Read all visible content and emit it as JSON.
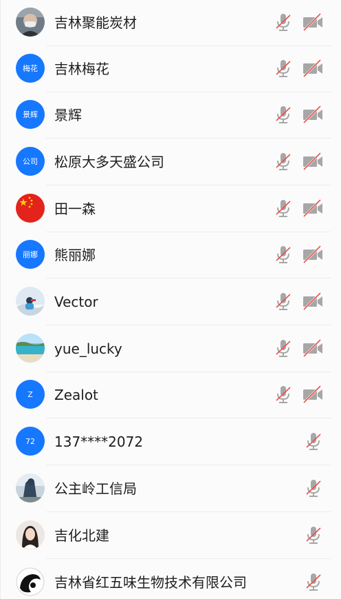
{
  "participants": [
    {
      "name": "吉林聚能炭材",
      "avatar_text": "",
      "avatar_kind": "photo-mask",
      "mic_muted": true,
      "camera_off": true,
      "has_camera_icon": true
    },
    {
      "name": "吉林梅花",
      "avatar_text": "梅花",
      "avatar_kind": "text",
      "mic_muted": true,
      "camera_off": true,
      "has_camera_icon": true
    },
    {
      "name": "景辉",
      "avatar_text": "景辉",
      "avatar_kind": "text",
      "mic_muted": true,
      "camera_off": true,
      "has_camera_icon": true
    },
    {
      "name": "松原大多天盛公司",
      "avatar_text": "公司",
      "avatar_kind": "text",
      "mic_muted": true,
      "camera_off": true,
      "has_camera_icon": true
    },
    {
      "name": "田一森",
      "avatar_text": "",
      "avatar_kind": "photo-flag",
      "mic_muted": true,
      "camera_off": true,
      "has_camera_icon": true
    },
    {
      "name": "熊丽娜",
      "avatar_text": "丽娜",
      "avatar_kind": "text",
      "mic_muted": true,
      "camera_off": true,
      "has_camera_icon": true
    },
    {
      "name": "Vector",
      "avatar_text": "",
      "avatar_kind": "photo-snow",
      "mic_muted": true,
      "camera_off": true,
      "has_camera_icon": true
    },
    {
      "name": "yue_lucky",
      "avatar_text": "",
      "avatar_kind": "photo-beach",
      "mic_muted": true,
      "camera_off": true,
      "has_camera_icon": true
    },
    {
      "name": "Zealot",
      "avatar_text": "Z",
      "avatar_kind": "text",
      "mic_muted": true,
      "camera_off": true,
      "has_camera_icon": true
    },
    {
      "name": "137****2072",
      "avatar_text": "72",
      "avatar_kind": "text",
      "mic_muted": true,
      "camera_off": false,
      "has_camera_icon": false
    },
    {
      "name": "公主岭工信局",
      "avatar_text": "",
      "avatar_kind": "photo-statue",
      "mic_muted": true,
      "camera_off": false,
      "has_camera_icon": false
    },
    {
      "name": "吉化北建",
      "avatar_text": "",
      "avatar_kind": "photo-girl",
      "mic_muted": true,
      "camera_off": false,
      "has_camera_icon": false
    },
    {
      "name": "吉林省红五味生物技术有限公司",
      "avatar_text": "",
      "avatar_kind": "photo-bw",
      "mic_muted": true,
      "camera_off": false,
      "has_camera_icon": false
    }
  ],
  "colors": {
    "avatar_blue": "#1677ff",
    "icon_grey": "#a7a7a7",
    "mute_slash": "#e8504a",
    "divider": "#ececec"
  },
  "icons": {
    "mic": "mic-muted-icon",
    "camera": "camera-off-icon"
  }
}
